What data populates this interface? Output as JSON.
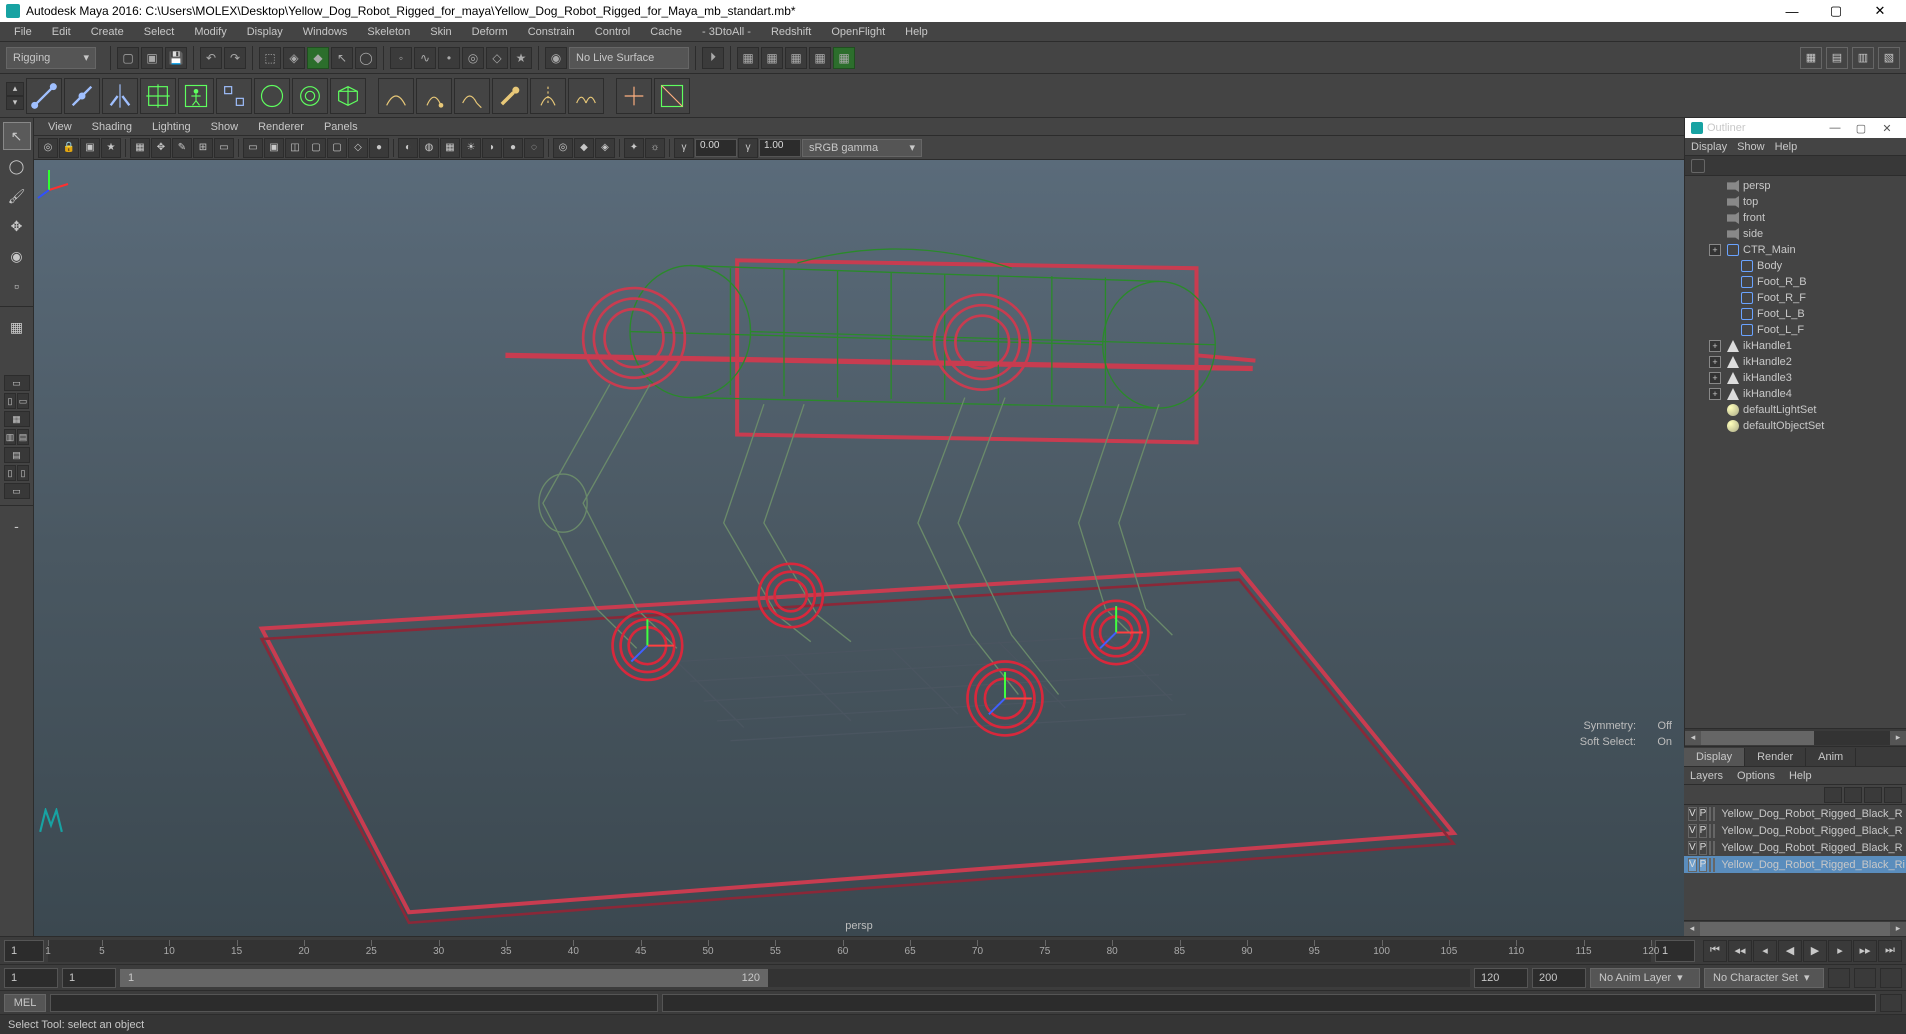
{
  "window": {
    "title": "Autodesk Maya 2016: C:\\Users\\MOLEX\\Desktop\\Yellow_Dog_Robot_Rigged_for_maya\\Yellow_Dog_Robot_Rigged_for_Maya_mb_standart.mb*"
  },
  "menubar": [
    "File",
    "Edit",
    "Create",
    "Select",
    "Modify",
    "Display",
    "Windows",
    "Skeleton",
    "Skin",
    "Deform",
    "Constrain",
    "Control",
    "Cache",
    "- 3DtoAll -",
    "Redshift",
    "OpenFlight",
    "Help"
  ],
  "workspace": {
    "selected": "Rigging"
  },
  "shelf": {
    "live_surface": "No Live Surface"
  },
  "viewport": {
    "menus": [
      "View",
      "Shading",
      "Lighting",
      "Show",
      "Renderer",
      "Panels"
    ],
    "gamma_a": "0.00",
    "gamma_b": "1.00",
    "color_mgmt": "sRGB gamma",
    "camera_name": "persp",
    "symmetry_label": "Symmetry:",
    "symmetry_value": "Off",
    "softsel_label": "Soft Select:",
    "softsel_value": "On"
  },
  "outliner": {
    "title": "Outliner",
    "menus": [
      "Display",
      "Show",
      "Help"
    ],
    "items": [
      {
        "name": "persp",
        "type": "cam",
        "dim": true
      },
      {
        "name": "top",
        "type": "cam",
        "dim": true
      },
      {
        "name": "front",
        "type": "cam",
        "dim": true
      },
      {
        "name": "side",
        "type": "cam",
        "dim": true
      },
      {
        "name": "CTR_Main",
        "type": "nurbs",
        "expand": true
      },
      {
        "name": "Body",
        "type": "nurbs"
      },
      {
        "name": "Foot_R_B",
        "type": "nurbs"
      },
      {
        "name": "Foot_R_F",
        "type": "nurbs"
      },
      {
        "name": "Foot_L_B",
        "type": "nurbs"
      },
      {
        "name": "Foot_L_F",
        "type": "nurbs"
      },
      {
        "name": "ikHandle1",
        "type": "ik",
        "expand": true
      },
      {
        "name": "ikHandle2",
        "type": "ik",
        "expand": true
      },
      {
        "name": "ikHandle3",
        "type": "ik",
        "expand": true
      },
      {
        "name": "ikHandle4",
        "type": "ik",
        "expand": true
      },
      {
        "name": "defaultLightSet",
        "type": "set"
      },
      {
        "name": "defaultObjectSet",
        "type": "set"
      }
    ]
  },
  "channelbox": {
    "tabs": [
      "Display",
      "Render",
      "Anim"
    ],
    "active_tab": 0,
    "menus": [
      "Layers",
      "Options",
      "Help"
    ],
    "layers": [
      {
        "v": "V",
        "p": "P",
        "color": "#0a5a0a",
        "name": "Yellow_Dog_Robot_Rigged_Black_R",
        "sel": false
      },
      {
        "v": "V",
        "p": "P",
        "color": "#0a0aff",
        "name": "Yellow_Dog_Robot_Rigged_Black_R",
        "sel": false
      },
      {
        "v": "V",
        "p": "P",
        "color": "#0a0a5a",
        "name": "Yellow_Dog_Robot_Rigged_Black_R",
        "sel": false
      },
      {
        "v": "V",
        "p": "P",
        "color": "#ff2a2a",
        "name": "Yellow_Dog_Robot_Rigged_Black_Ri",
        "sel": true
      }
    ]
  },
  "timeline": {
    "current": "1",
    "ticks": [
      1,
      5,
      10,
      15,
      20,
      25,
      30,
      35,
      40,
      45,
      50,
      55,
      60,
      65,
      70,
      75,
      80,
      85,
      90,
      95,
      100,
      105,
      110,
      115,
      120
    ],
    "current_right": "1"
  },
  "range": {
    "anim_start": "1",
    "play_start": "1",
    "thumb_start": "1",
    "thumb_end": "120",
    "play_end": "120",
    "anim_end": "200",
    "anim_layer": "No Anim Layer",
    "char_set": "No Character Set"
  },
  "cmd": {
    "lang": "MEL"
  },
  "helpline": "Select Tool: select an object"
}
